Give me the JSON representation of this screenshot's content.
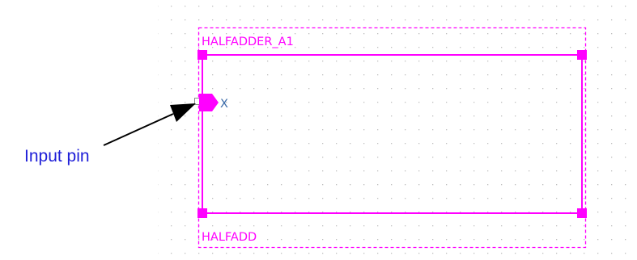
{
  "schematic": {
    "instance_name": "HALFADDER_A1",
    "cell_name": "HALFADD",
    "pin_name": "X",
    "colors": {
      "component": "#ff00ff",
      "pin_label": "#3a6aa8",
      "grid_dot": "#bfbfbf",
      "pin_stub": "#8a8a8a"
    }
  },
  "annotation": {
    "label": "Input pin",
    "color": "#1f1fd8",
    "arrow_color": "#000000"
  }
}
